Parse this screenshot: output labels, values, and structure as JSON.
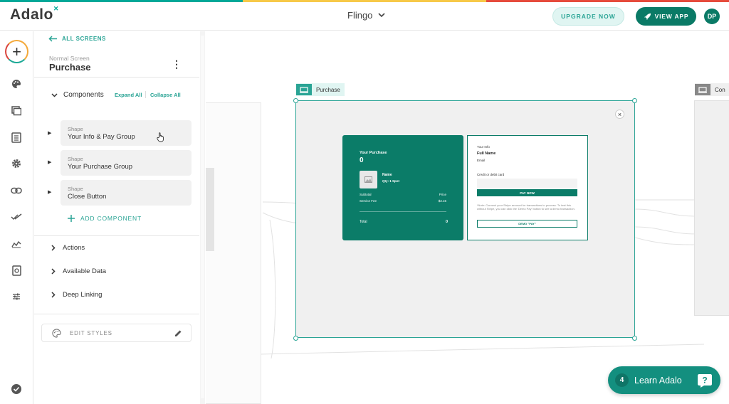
{
  "colors": {
    "brand": "#0a7a66",
    "accent": "#2aa495",
    "stripe": [
      "#00a898",
      "#f7c948",
      "#e64b3c"
    ]
  },
  "topbar": {
    "logo": "Adalo",
    "app_name": "Flingo",
    "upgrade_label": "UPGRADE NOW",
    "view_app_label": "VIEW APP",
    "avatar_initials": "DP"
  },
  "rail": {
    "icons": [
      "add-icon",
      "palette-icon",
      "screens-icon",
      "database-icon",
      "settings-icon",
      "link-icon",
      "checkmark-icon",
      "analytics-icon",
      "publish-icon",
      "sliders-icon",
      "verified-icon"
    ]
  },
  "panel": {
    "back_label": "ALL SCREENS",
    "screen_type": "Normal Screen",
    "screen_name": "Purchase",
    "components_label": "Components",
    "expand_all": "Expand All",
    "collapse_all": "Collapse All",
    "components": [
      {
        "type": "Shape",
        "name": "Your Info & Pay Group"
      },
      {
        "type": "Shape",
        "name": "Your Purchase Group"
      },
      {
        "type": "Shape",
        "name": "Close Button"
      }
    ],
    "add_component": "ADD COMPONENT",
    "sections": [
      "Actions",
      "Available Data",
      "Deep Linking"
    ],
    "edit_styles": "EDIT STYLES"
  },
  "canvas": {
    "screen_tag": "Purchase",
    "next_screen_tag": "Con",
    "close_glyph": "×",
    "purchase_card": {
      "title": "Your Purchase",
      "amount": "0",
      "item_name": "Name",
      "item_qty": "Qty: 1 Spot",
      "subtotal_label": "Subtotal",
      "subtotal_value": "Price",
      "fee_label": "Service Fee",
      "fee_value": "$3.15",
      "total_label": "Total",
      "total_value": "0"
    },
    "pay_card": {
      "info_label": "Your Info",
      "full_name": "Full Name",
      "email": "Email",
      "card_label": "Credit or debit card",
      "pay_now": "PAY NOW",
      "note": "*Note: Connect your Stripe account for transactions to process. To test this without Stripe, you can click the 'Demo Pay' button to see a demo transaction.",
      "demo_pay": "DEMO \"PAY\""
    }
  },
  "learn": {
    "count": "4",
    "label": "Learn Adalo"
  }
}
